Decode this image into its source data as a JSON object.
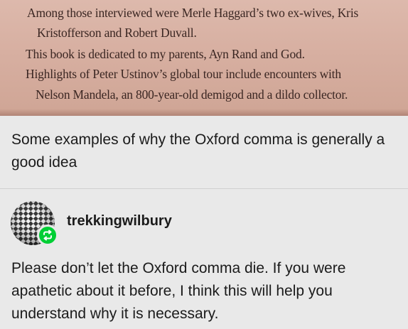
{
  "image_text": {
    "lines": [
      "Among those interviewed were Merle Haggard’s two ex-wives, Kris",
      "Kristofferson and Robert Duvall.",
      "This book is dedicated to my parents, Ayn Rand and God.",
      "Highlights of Peter Ustinov’s global tour include encounters with",
      "Nelson Mandela, an 800-year-old demigod and a dildo collector."
    ]
  },
  "caption": "Some examples of why the Oxford comma is generally a good idea",
  "reblog": {
    "username": "trekkingwilbury",
    "avatar_icon": "checkered-avatar",
    "badge_icon": "reblog-icon",
    "badge_color": "#00cf35",
    "body": "Please don’t let the Oxford comma die. If you were apathetic about it before, I think this will help you understand why it is necessary."
  }
}
